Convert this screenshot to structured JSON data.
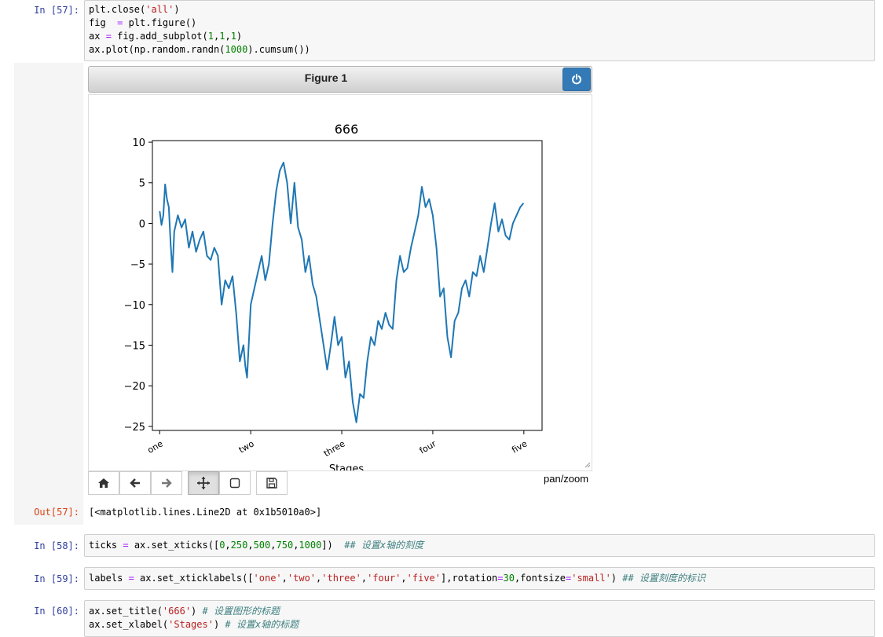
{
  "cells": [
    {
      "prompt": "In  [57]:",
      "lines": [
        [
          [
            "plain",
            "plt.close("
          ],
          [
            "str",
            "'all'"
          ],
          [
            "plain",
            ")"
          ]
        ],
        [
          [
            "plain",
            "fig  "
          ],
          [
            "op",
            "="
          ],
          [
            "plain",
            " plt.figure()"
          ]
        ],
        [
          [
            "plain",
            "ax "
          ],
          [
            "op",
            "="
          ],
          [
            "plain",
            " fig.add_subplot("
          ],
          [
            "num",
            "1"
          ],
          [
            "plain",
            ","
          ],
          [
            "num",
            "1"
          ],
          [
            "plain",
            ","
          ],
          [
            "num",
            "1"
          ],
          [
            "plain",
            ")"
          ]
        ],
        [
          [
            "plain",
            "ax.plot(np.random.randn("
          ],
          [
            "num",
            "1000"
          ],
          [
            "plain",
            ").cumsum())"
          ]
        ]
      ]
    },
    {
      "prompt": "In  [58]:",
      "lines": [
        [
          [
            "plain",
            "ticks "
          ],
          [
            "op",
            "="
          ],
          [
            "plain",
            " ax.set_xticks(["
          ],
          [
            "num",
            "0"
          ],
          [
            "plain",
            ","
          ],
          [
            "num",
            "250"
          ],
          [
            "plain",
            ","
          ],
          [
            "num",
            "500"
          ],
          [
            "plain",
            ","
          ],
          [
            "num",
            "750"
          ],
          [
            "plain",
            ","
          ],
          [
            "num",
            "1000"
          ],
          [
            "plain",
            "])  "
          ],
          [
            "cm",
            "## 设置x轴的刻度"
          ]
        ]
      ]
    },
    {
      "prompt": "In  [59]:",
      "lines": [
        [
          [
            "plain",
            "labels "
          ],
          [
            "op",
            "="
          ],
          [
            "plain",
            " ax.set_xticklabels(["
          ],
          [
            "str",
            "'one'"
          ],
          [
            "plain",
            ","
          ],
          [
            "str",
            "'two'"
          ],
          [
            "plain",
            ","
          ],
          [
            "str",
            "'three'"
          ],
          [
            "plain",
            ","
          ],
          [
            "str",
            "'four'"
          ],
          [
            "plain",
            ","
          ],
          [
            "str",
            "'five'"
          ],
          [
            "plain",
            "],rotation"
          ],
          [
            "op",
            "="
          ],
          [
            "num",
            "30"
          ],
          [
            "plain",
            ",fontsize"
          ],
          [
            "op",
            "="
          ],
          [
            "str",
            "'small'"
          ],
          [
            "plain",
            ") "
          ],
          [
            "cm",
            "## 设置刻度的标识"
          ]
        ]
      ]
    },
    {
      "prompt": "In  [60]:",
      "lines": [
        [
          [
            "plain",
            "ax.set_title("
          ],
          [
            "str",
            "'666'"
          ],
          [
            "plain",
            ") "
          ],
          [
            "cm",
            "# 设置图形的标题"
          ]
        ],
        [
          [
            "plain",
            "ax.set_xlabel("
          ],
          [
            "str",
            "'Stages'"
          ],
          [
            "plain",
            ") "
          ],
          [
            "cm",
            "# 设置x轴的标题"
          ]
        ]
      ]
    }
  ],
  "output": {
    "prompt": "Out[57]:",
    "text": "[<matplotlib.lines.Line2D at 0x1b5010a0>]"
  },
  "figure": {
    "title": "Figure 1",
    "status": "pan/zoom",
    "icons": {
      "power": "power-icon",
      "toolbar": [
        "home-icon",
        "back-arrow-icon",
        "forward-arrow-icon",
        "move-icon",
        "zoom-rect-icon",
        "save-icon"
      ]
    },
    "colors": {
      "power_button": "#337ab7",
      "line": "#1f77b4"
    }
  },
  "chart_data": {
    "type": "line",
    "title": "666",
    "xlabel": "Stages",
    "ylabel": "",
    "xlim": [
      -20,
      1050
    ],
    "ylim": [
      -25.5,
      10.2
    ],
    "xticks": [
      0,
      250,
      500,
      750,
      1000
    ],
    "xticklabels": [
      "one",
      "two",
      "three",
      "four",
      "five"
    ],
    "xtick_rotation": 30,
    "yticks": [
      -25,
      -20,
      -15,
      -10,
      -5,
      0,
      5,
      10
    ],
    "yticklabels": [
      "−25",
      "−20",
      "−15",
      "−10",
      "−5",
      "0",
      "5",
      "10"
    ],
    "series": [
      {
        "x": [
          0,
          5,
          10,
          15,
          20,
          25,
          30,
          35,
          40,
          50,
          60,
          70,
          80,
          90,
          100,
          110,
          120,
          130,
          140,
          150,
          160,
          170,
          180,
          190,
          200,
          210,
          220,
          230,
          235,
          240,
          250,
          260,
          270,
          280,
          290,
          300,
          310,
          320,
          330,
          340,
          350,
          360,
          370,
          380,
          390,
          400,
          410,
          420,
          430,
          440,
          450,
          460,
          470,
          480,
          490,
          500,
          510,
          520,
          530,
          540,
          550,
          560,
          570,
          580,
          590,
          600,
          610,
          620,
          630,
          640,
          650,
          660,
          670,
          680,
          690,
          700,
          710,
          720,
          730,
          740,
          750,
          760,
          770,
          780,
          790,
          800,
          810,
          820,
          830,
          840,
          850,
          860,
          870,
          880,
          890,
          900,
          910,
          920,
          930,
          940,
          950,
          960,
          970,
          980,
          990,
          999
        ],
        "y": [
          1.5,
          -0.2,
          1.0,
          4.8,
          3.0,
          2.0,
          -2.5,
          -6.0,
          -1.0,
          1.0,
          -0.5,
          0.5,
          -3.0,
          -1.0,
          -3.5,
          -2.0,
          -1.0,
          -4.0,
          -4.5,
          -3.0,
          -4.0,
          -10.0,
          -7.0,
          -8.0,
          -6.5,
          -11.0,
          -17.0,
          -15.0,
          -17.5,
          -19.0,
          -10.0,
          -8.0,
          -6.0,
          -4.0,
          -7.0,
          -5.0,
          0.0,
          4.0,
          6.5,
          7.5,
          5.0,
          0.0,
          5.0,
          -0.5,
          -2.0,
          -6.0,
          -4.0,
          -7.5,
          -9.0,
          -12.0,
          -15.0,
          -18.0,
          -15.0,
          -11.5,
          -15.0,
          -14.0,
          -19.0,
          -17.0,
          -22.0,
          -24.5,
          -21.0,
          -21.5,
          -17.0,
          -14.0,
          -15.0,
          -12.0,
          -13.0,
          -11.0,
          -12.5,
          -13.0,
          -7.0,
          -4.0,
          -6.0,
          -5.5,
          -3.0,
          -1.0,
          1.0,
          4.5,
          2.0,
          3.0,
          1.0,
          -3.0,
          -9.0,
          -8.0,
          -14.0,
          -16.5,
          -12.0,
          -11.0,
          -8.0,
          -7.0,
          -9.0,
          -6.0,
          -6.5,
          -4.0,
          -6.0,
          -3.0,
          0.0,
          2.5,
          -1.0,
          0.5,
          -1.5,
          -2.0,
          0.0,
          1.0,
          2.0,
          2.5
        ]
      }
    ]
  }
}
